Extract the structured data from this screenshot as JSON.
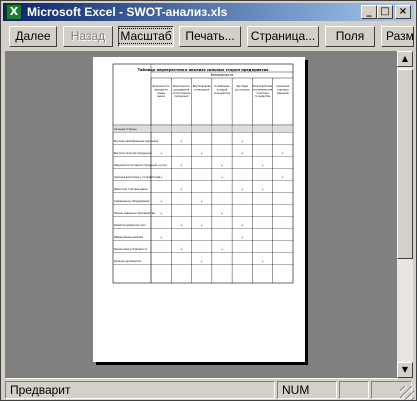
{
  "window": {
    "title": "Microsoft Excel - SWOT-анализ.xls",
    "icon": "excel-icon",
    "controls": {
      "minimize": "_",
      "maximize": "□",
      "close": "×"
    }
  },
  "toolbar": {
    "next_label": "Далее",
    "back_label": "Назад",
    "zoom_label": "Масштаб",
    "print_label": "Печать...",
    "page_setup_label": "Страница...",
    "margins_label": "Поля",
    "page_break_label": "Разме"
  },
  "scrollbar": {
    "up_arrow": "▲",
    "down_arrow": "▼"
  },
  "page_preview": {
    "title": "Таблица перекрестного анализа сильных сторон предприятия",
    "subheader": "Возможности",
    "column_headers": [
      "Возможность выхода на новые рынки",
      "Возможность расширения ассортимента продукции",
      "Вертикальная интеграция",
      "Ослабление позиций конкурентов",
      "Быстрый рост рынка",
      "Благоприятная экономическая политика государства",
      "Снижение торговых барьеров"
    ],
    "rows": [
      {
        "label": "Сильные стороны",
        "cells": [
          "",
          "",
          "",
          "",
          "",
          "",
          ""
        ]
      },
      {
        "label": "Высокая квалификация персонала",
        "cells": [
          "",
          "+",
          "",
          "",
          "+",
          "",
          ""
        ]
      },
      {
        "label": "Высокое качество продукции",
        "cells": [
          "+",
          "",
          "+",
          "",
          "+",
          "",
          "+"
        ]
      },
      {
        "label": "Широкий ассортимент продукции и услуг",
        "cells": [
          "",
          "+",
          "",
          "+",
          "",
          "+",
          ""
        ]
      },
      {
        "label": "Хорошая репутация у потребителей",
        "cells": [
          "+",
          "",
          "",
          "+",
          "",
          "",
          "+"
        ]
      },
      {
        "label": "Известная торговая марка",
        "cells": [
          "",
          "+",
          "",
          "",
          "+",
          "+",
          ""
        ]
      },
      {
        "label": "Современное оборудование",
        "cells": [
          "+",
          "",
          "+",
          "",
          "",
          "",
          ""
        ]
      },
      {
        "label": "Низкие издержки производства",
        "cells": [
          "+",
          "",
          "",
          "+",
          "",
          "",
          ""
        ]
      },
      {
        "label": "Развитая дилерская сеть",
        "cells": [
          "",
          "+",
          "+",
          "",
          "+",
          "",
          ""
        ]
      },
      {
        "label": "Эффективная реклама",
        "cells": [
          "+",
          "",
          "",
          "",
          "+",
          "",
          ""
        ]
      },
      {
        "label": "Финансовая устойчивость",
        "cells": [
          "",
          "+",
          "",
          "+",
          "",
          "",
          ""
        ]
      },
      {
        "label": "Сильное руководство",
        "cells": [
          "",
          "",
          "+",
          "",
          "",
          "+",
          ""
        ]
      }
    ]
  },
  "status": {
    "mode": "Предварит",
    "num_lock": "NUM"
  }
}
